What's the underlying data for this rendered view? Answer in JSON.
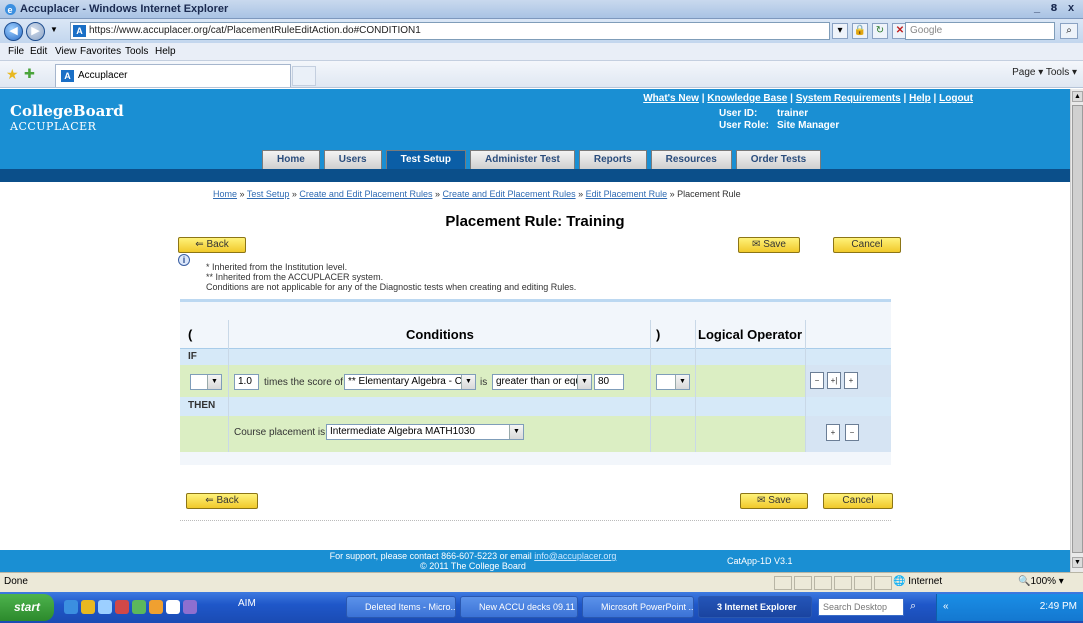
{
  "window": {
    "title": "Accuplacer - Windows Internet Explorer",
    "min": "_",
    "max": "8",
    "close": "x"
  },
  "addressbar": {
    "url": "https://www.accuplacer.org/cat/PlacementRuleEditAction.do#CONDITION1",
    "search_placeholder": "Google"
  },
  "menubar": [
    "File",
    "Edit",
    "View",
    "Favorites",
    "Tools",
    "Help"
  ],
  "favbar": {
    "tab_label": "Accuplacer",
    "commands": "Page ▾   Tools ▾"
  },
  "site": {
    "brand": "CollegeBoard",
    "product": "ACCUPLACER",
    "top_links": [
      "What's New",
      "Knowledge Base",
      "System Requirements",
      "Help",
      "Logout"
    ],
    "user_id_label": "User ID:",
    "user_id": "trainer",
    "user_role_label": "User Role:",
    "user_role": "Site Manager",
    "nav_tabs": [
      "Home",
      "Users",
      "Test Setup",
      "Administer Test",
      "Reports",
      "Resources",
      "Order Tests"
    ],
    "active_tab": "Test Setup"
  },
  "breadcrumb": {
    "links": [
      "Home",
      "Test Setup",
      "Create and Edit Placement Rules",
      "Create and Edit Placement Rules",
      "Edit Placement Rule"
    ],
    "current": "Placement Rule"
  },
  "page_title": "Placement Rule: Training",
  "buttons": {
    "back": "Back",
    "save": "Save",
    "cancel": "Cancel"
  },
  "notes": [
    "* Inherited from the Institution level.",
    "** Inherited from the ACCUPLACER system.",
    "Conditions are not applicable for any of the Diagnostic tests when creating and editing Rules."
  ],
  "rule_table": {
    "col_open_paren": "(",
    "col_conditions": "Conditions",
    "col_close_paren": ")",
    "col_logical_operator": "Logical Operator",
    "if_label": "IF",
    "then_label": "THEN",
    "condition": {
      "multiplier": "1.0",
      "times_text": "times the score of",
      "test": "** Elementary Algebra - C",
      "is_text": "is",
      "operator": "greater than or equ",
      "score": "80"
    },
    "placement_text": "Course placement is",
    "placement_value": "Intermediate Algebra MATH1030"
  },
  "footer": {
    "support_text": "For support, please contact 866-607-5223 or email",
    "support_email": "info@accuplacer.org",
    "copyright": "© 2011 The College Board",
    "version": "CatApp-1D  V3.1"
  },
  "statusbar": {
    "status": "Done",
    "zone": "Internet",
    "zoom": "100%"
  },
  "taskbar": {
    "start": "start",
    "aim": "AIM",
    "tasks": [
      "Deleted Items - Micro...",
      "New ACCU decks 09.11",
      "Microsoft PowerPoint ...",
      "3 Internet Explorer"
    ],
    "search_placeholder": "Search Desktop",
    "clock": "2:49 PM"
  }
}
